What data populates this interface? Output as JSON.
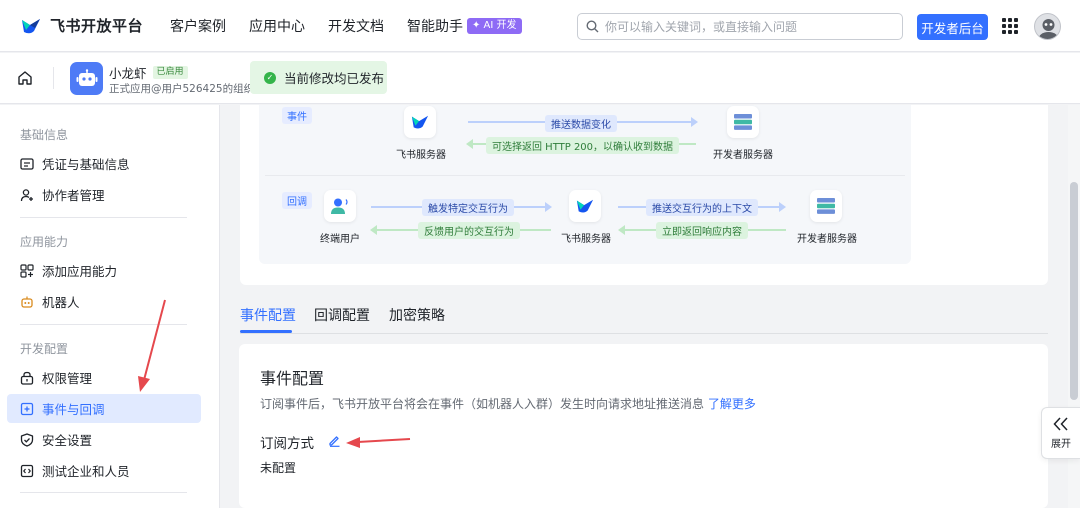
{
  "header": {
    "logo_text": "飞书开放平台",
    "nav": [
      "客户案例",
      "应用中心",
      "开发文档",
      "智能助手"
    ],
    "ai_badge": "✦ AI 开发",
    "search_placeholder": "你可以输入关键词，或直接输入问题",
    "dev_button": "开发者后台"
  },
  "subbar": {
    "app_name": "小龙虾",
    "app_status": "已启用",
    "app_org": "正式应用@用户526425的组织",
    "toast": "当前修改均已发布"
  },
  "sidebar": {
    "groups": [
      {
        "title": "基础信息",
        "items": [
          "凭证与基础信息",
          "协作者管理"
        ]
      },
      {
        "title": "应用能力",
        "items": [
          "添加应用能力",
          "机器人"
        ]
      },
      {
        "title": "开发配置",
        "items": [
          "权限管理",
          "事件与回调",
          "安全设置",
          "测试企业和人员"
        ]
      }
    ],
    "active_item": "事件与回调"
  },
  "flow": {
    "event_tag": "事件",
    "callback_tag": "回调",
    "event_nodes": [
      "飞书服务器",
      "开发者服务器"
    ],
    "event_arrows": [
      "推送数据变化",
      "可选择返回 HTTP 200，以确认收到数据"
    ],
    "callback_nodes": [
      "终端用户",
      "飞书服务器",
      "开发者服务器"
    ],
    "callback_arrows": [
      "触发特定交互行为",
      "反馈用户的交互行为",
      "推送交互行为的上下文",
      "立即返回响应内容"
    ]
  },
  "tabs": [
    "事件配置",
    "回调配置",
    "加密策略"
  ],
  "active_tab": "事件配置",
  "event_config": {
    "title": "事件配置",
    "description": "订阅事件后，飞书开放平台将会在事件（如机器人入群）发生时向请求地址推送消息",
    "learn_more": "了解更多",
    "subscription_label": "订阅方式",
    "subscription_value": "未配置"
  },
  "expand_panel": {
    "label": "展开"
  },
  "colors": {
    "accent": "#3370ff",
    "active_bg": "#e1eaff",
    "success": "#34b44a"
  }
}
